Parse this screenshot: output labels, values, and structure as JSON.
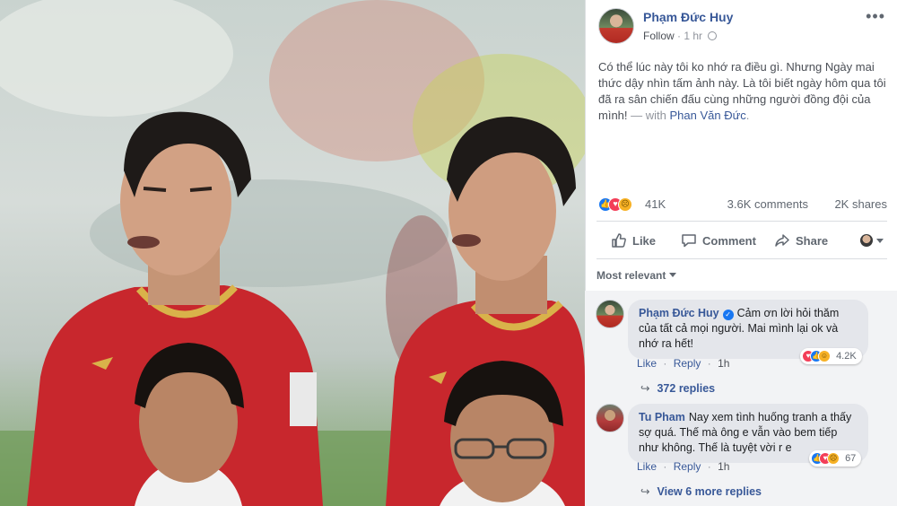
{
  "post": {
    "author": "Phạm Đức Huy",
    "follow_label": "Follow",
    "separator": "·",
    "time": "1 hr",
    "more_icon": "ellipsis-icon",
    "text_main": "Có thể lúc này tôi ko nhớ ra điều gì. Nhưng Ngày mai thức dậy nhìn tấm ảnh này. Là tôi biết ngày hôm qua tôi đã ra sân chiến đấu cùng những người đồng đội của mình!",
    "with_text": " — with ",
    "tagged": "Phan Văn Đức",
    "tagged_end": "."
  },
  "stats": {
    "reactions": "41K",
    "comments": "3.6K comments",
    "shares": "2K shares"
  },
  "actions": {
    "like": "Like",
    "comment": "Comment",
    "share": "Share"
  },
  "sort": {
    "label": "Most relevant"
  },
  "comments": [
    {
      "name": "Phạm Đức Huy",
      "verified": true,
      "text": "Cảm ơn lời hỏi thăm của tất cả mọi người. Mai mình lại ok và nhớ ra hết!",
      "like": "Like",
      "reply": "Reply",
      "dot": "·",
      "time": "1h",
      "reactions": "4.2K",
      "replies": "372 replies"
    },
    {
      "name": "Tu Pham",
      "verified": false,
      "text": "Nay xem tình huống tranh a thấy sợ quá. Thế mà ông e vẫn vào bem tiếp như không. Thế là tuyệt vời r e",
      "like": "Like",
      "reply": "Reply",
      "dot": "·",
      "time": "1h",
      "reactions": "67",
      "replies": "View 6 more replies"
    }
  ],
  "colors": {
    "link": "#385898",
    "like_blue": "#1877f2",
    "love_red": "#f33e58",
    "sad_yellow": "#f7b125",
    "jersey_red": "#c8272d",
    "jersey_gold": "#d9b24a"
  }
}
